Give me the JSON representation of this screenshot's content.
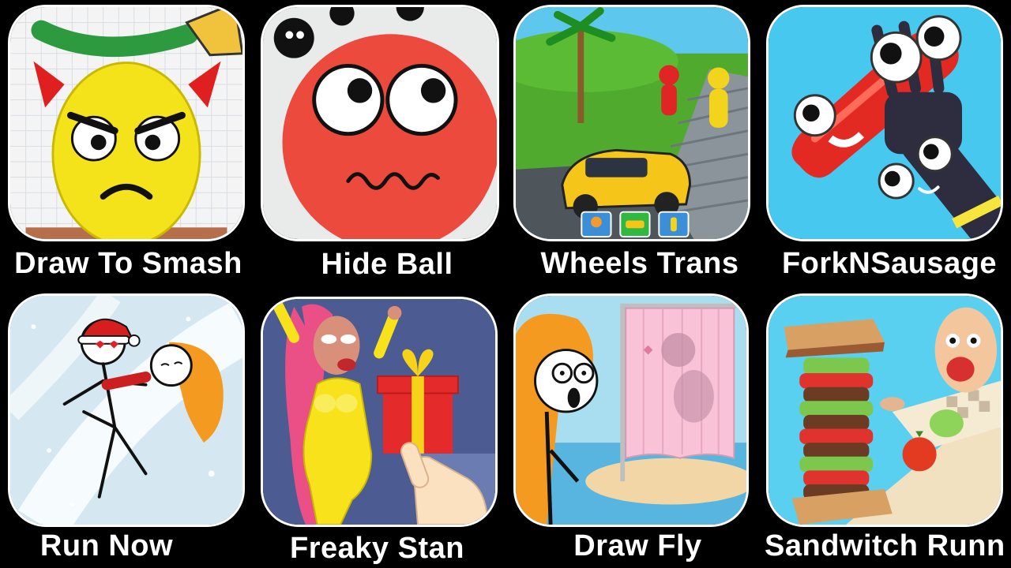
{
  "games": [
    {
      "id": "draw-to-smash",
      "label": "Draw To Smash",
      "icon": "angry-egg-devil-horns-icon",
      "colors": {
        "bg": "#f4f4f4",
        "accent": "#f2e21a"
      }
    },
    {
      "id": "hide-ball",
      "label": "Hide Ball",
      "icon": "red-ball-worried-face-icon",
      "colors": {
        "bg": "#e9eaea",
        "accent": "#ec4a3c"
      }
    },
    {
      "id": "wheels-trans",
      "label": "Wheels Trans",
      "icon": "yellow-car-stair-runners-icon",
      "colors": {
        "bg": "#5ec7ee",
        "accent": "#f5c51a"
      }
    },
    {
      "id": "forknsausage",
      "label": "ForkNSausage",
      "icon": "sausage-on-fork-icon",
      "colors": {
        "bg": "#47c8ef",
        "accent": "#e32a22"
      }
    },
    {
      "id": "run-now",
      "label": "Run Now",
      "icon": "stickman-santa-hug-icon",
      "colors": {
        "bg": "#e6f1f7",
        "accent": "#cc1f1f"
      }
    },
    {
      "id": "freaky-stan",
      "label": "Freaky Stan",
      "icon": "yellow-suit-gift-icon",
      "colors": {
        "bg": "#4c5b91",
        "accent": "#f7e21b"
      }
    },
    {
      "id": "draw-fly",
      "label": "Draw Fly",
      "icon": "shocked-girl-curtain-icon",
      "colors": {
        "bg": "#a9def0",
        "accent": "#f9c2d7"
      }
    },
    {
      "id": "sandwitch-runner",
      "label": "Sandwitch Runn",
      "icon": "sandwich-tower-icon",
      "colors": {
        "bg": "#5ad0f0",
        "accent": "#9c5a33"
      }
    }
  ]
}
